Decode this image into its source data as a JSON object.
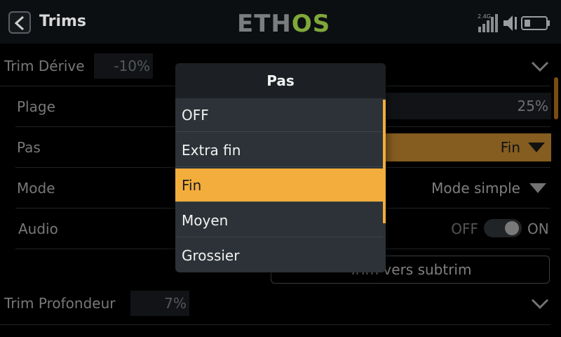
{
  "header": {
    "title": "Trims",
    "logo_part1": "ETH",
    "logo_part2": "OS",
    "signal_label": "2.4G"
  },
  "rows": {
    "trim1_label": "Trim Dérive",
    "trim1_value": "-10%",
    "plage_label": "Plage",
    "plage_value": "25%",
    "pas_label": "Pas",
    "pas_value": "Fin",
    "mode_label": "Mode",
    "mode_value": "Mode simple",
    "audio_label": "Audio",
    "audio_off": "OFF",
    "audio_on": "ON",
    "subtrim_button": "Trim vers subtrim",
    "trim2_label": "Trim Profondeur",
    "trim2_value": "7%"
  },
  "popup": {
    "title": "Pas",
    "options": [
      "OFF",
      "Extra fin",
      "Fin",
      "Moyen",
      "Grossier"
    ],
    "selected_index": 2
  },
  "colors": {
    "accent": "#f2ad3c",
    "logo_green": "#7fa83a"
  }
}
